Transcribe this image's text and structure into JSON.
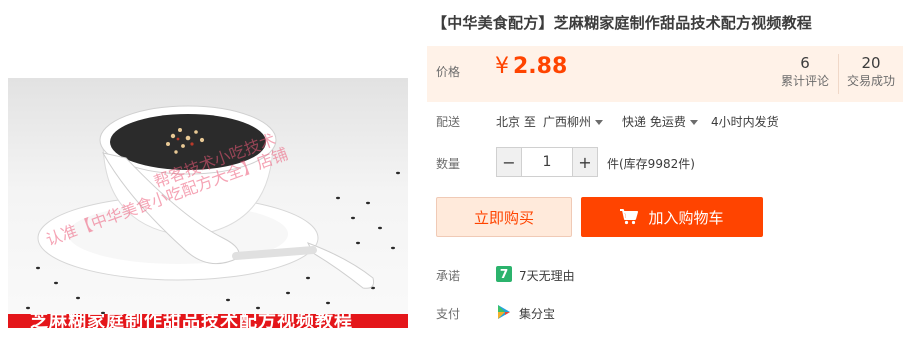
{
  "product": {
    "title": "【中华美食配方】芝麻糊家庭制作甜品技术配方视频教程",
    "image": {
      "banner_text": "芝麻糊家庭制作甜品技术配方视频教程",
      "watermark_lines": [
        "认准【中华美食小吃配方大全】店铺",
        "帮客技术小吃技术"
      ]
    }
  },
  "price": {
    "label": "价格",
    "currency": "¥",
    "value": "2.88"
  },
  "stats": [
    {
      "value": "6",
      "label": "累计评论"
    },
    {
      "value": "20",
      "label": "交易成功"
    }
  ],
  "shipping": {
    "label": "配送",
    "origin": "北京 至",
    "destination": "广西柳州",
    "method": "快递 免运费",
    "dispatch": "4小时内发货"
  },
  "quantity": {
    "label": "数量",
    "decrement": "−",
    "value": "1",
    "increment": "+",
    "stock": "件(库存9982件)"
  },
  "actions": {
    "buy_now": "立即购买",
    "add_to_cart": "加入购物车"
  },
  "promise": {
    "label": "承诺",
    "icon_text": "7",
    "text": "7天无理由"
  },
  "payment": {
    "label": "支付",
    "text": "集分宝"
  },
  "colors": {
    "accent": "#ff4400",
    "price_bg": "#fff2e8",
    "promise_green": "#2bb36c",
    "banner_red": "#e4161a"
  }
}
